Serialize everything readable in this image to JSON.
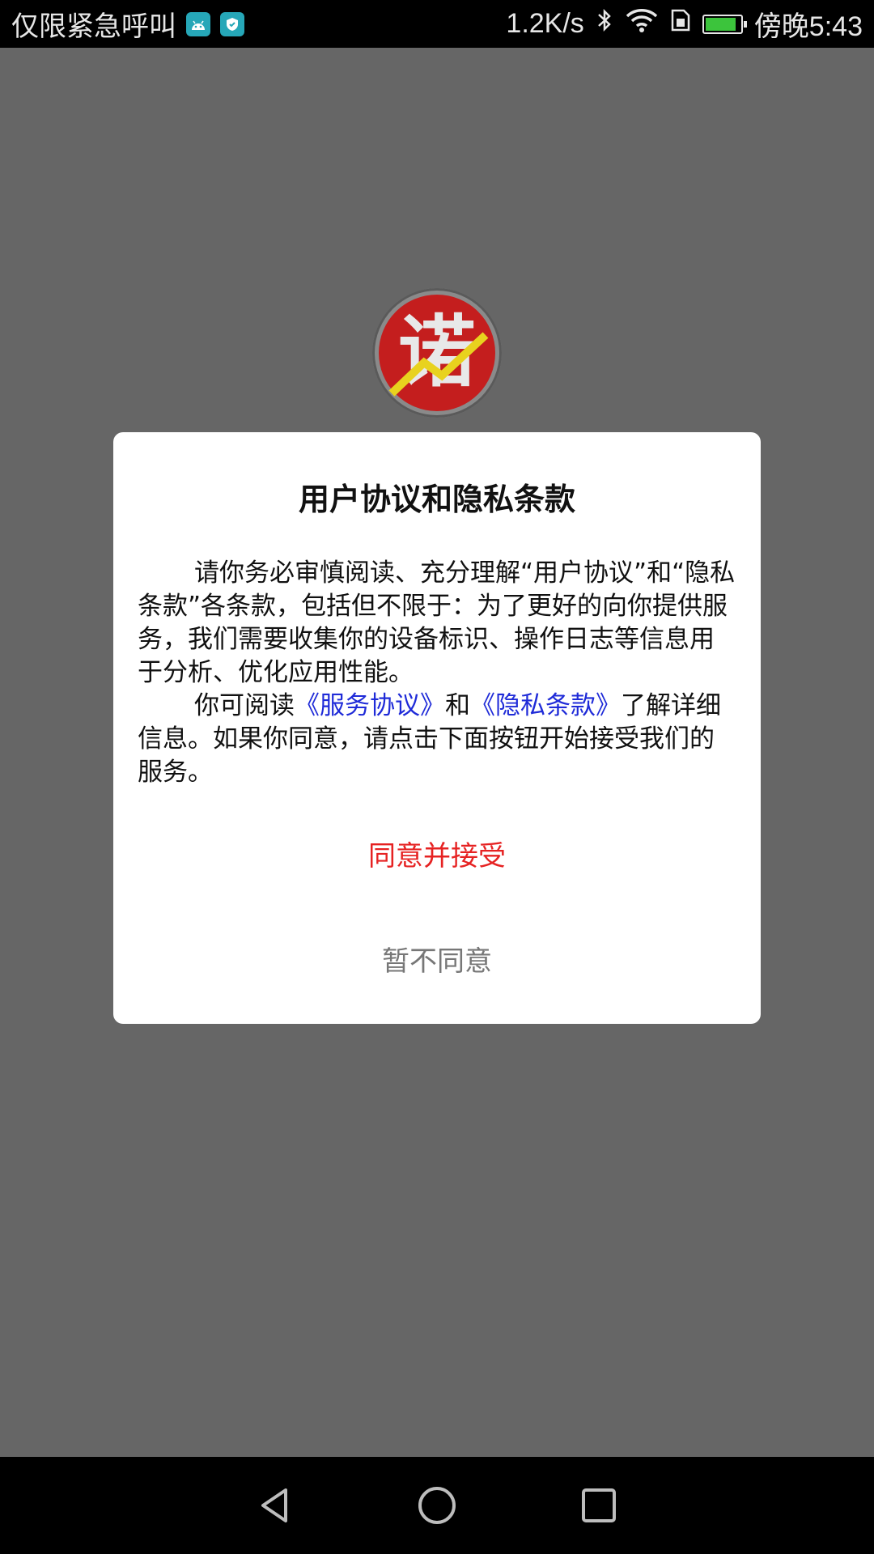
{
  "status_bar": {
    "carrier": "仅限紧急呼叫",
    "speed": "1.2K/s",
    "time": "傍晚5:43",
    "battery_level": 0.9,
    "icons": [
      "android-notification-icon",
      "shield-notification-icon",
      "bluetooth-icon",
      "wifi-icon",
      "sim-icon",
      "battery-icon"
    ]
  },
  "logo": {
    "text": "诺",
    "colors": {
      "ring": "#8a8a8a",
      "disc": "#c41e1e",
      "mark": "#e8d21e"
    }
  },
  "dialog": {
    "title": "用户协议和隐私条款",
    "paragraph1": "请你务必审慎阅读、充分理解“用户协议”和“隐私条款”各条款，包括但不限于：为了更好的向你提供服务，我们需要收集你的设备标识、操作日志等信息用于分析、优化应用性能。",
    "paragraph2_prefix": "你可阅读",
    "service_link": "《服务协议》",
    "conjunction": "和",
    "privacy_link": "《隐私条款》",
    "paragraph2_suffix": "了解详细信息。如果你同意，请点击下面按钮开始接受我们的服务。",
    "accept_label": "同意并接受",
    "decline_label": "暂不同意",
    "colors": {
      "accent": "#e62222",
      "link": "#1f2bd8",
      "muted": "#777777"
    }
  },
  "nav_bar": {
    "icons": [
      "back-icon",
      "home-icon",
      "recents-icon"
    ]
  }
}
